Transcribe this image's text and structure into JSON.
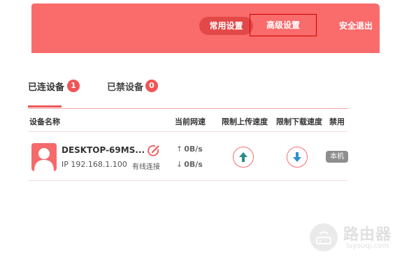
{
  "nav": {
    "common_label": "常用设置",
    "advanced_label": "高级设置",
    "logout_label": "安全退出"
  },
  "tabs": [
    {
      "label": "已连设备",
      "count": "1"
    },
    {
      "label": "已禁设备",
      "count": "0"
    }
  ],
  "columns": {
    "name": "设备名称",
    "speed": "当前网速",
    "upload_limit": "限制上传速度",
    "download_limit": "限制下载速度",
    "block": "禁用"
  },
  "devices": [
    {
      "name": "DESKTOP-69MS...",
      "ip": "IP 192.168.1.100",
      "connection": "有线连接",
      "up_speed": "0B/s",
      "down_speed": "0B/s",
      "block_tag": "本机"
    }
  ],
  "watermark": {
    "title": "路由器",
    "subtitle": "luyouqi.com"
  },
  "colors": {
    "accent": "#fa6b6b",
    "badge": "#f05555",
    "upload_arrow": "#2a8c8a",
    "download_arrow": "#2f8fd0"
  }
}
